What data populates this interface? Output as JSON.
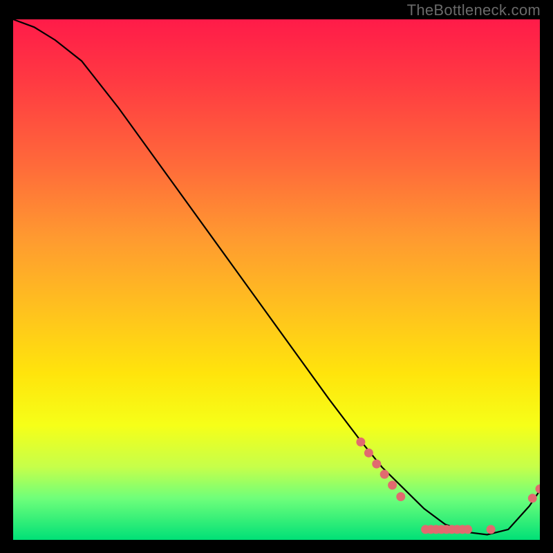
{
  "watermark": "TheBottleneck.com",
  "chart_data": {
    "type": "line",
    "title": "",
    "xlabel": "",
    "ylabel": "",
    "xlim": [
      0,
      100
    ],
    "ylim": [
      0,
      100
    ],
    "grid": false,
    "legend": false,
    "series": [
      {
        "name": "curve",
        "x": [
          0,
          4,
          8,
          13,
          20,
          30,
          40,
          50,
          60,
          66,
          70,
          74,
          78,
          82,
          86,
          90,
          94,
          98,
          100
        ],
        "y": [
          100,
          98.5,
          96,
          92,
          83,
          69,
          55,
          41,
          27,
          19,
          14,
          10,
          6,
          3,
          1.5,
          1,
          2,
          6.5,
          9.5
        ]
      }
    ],
    "markers": [
      {
        "x": 66.0,
        "y": 18.8
      },
      {
        "x": 67.5,
        "y": 16.7
      },
      {
        "x": 69.0,
        "y": 14.6
      },
      {
        "x": 70.5,
        "y": 12.6
      },
      {
        "x": 72.0,
        "y": 10.5
      },
      {
        "x": 73.6,
        "y": 8.3
      },
      {
        "x": 78.3,
        "y": 2.0
      },
      {
        "x": 79.3,
        "y": 2.0
      },
      {
        "x": 80.3,
        "y": 2.0
      },
      {
        "x": 81.3,
        "y": 2.0
      },
      {
        "x": 82.3,
        "y": 2.0
      },
      {
        "x": 83.3,
        "y": 2.0
      },
      {
        "x": 84.3,
        "y": 2.0
      },
      {
        "x": 85.3,
        "y": 2.0
      },
      {
        "x": 86.3,
        "y": 2.0
      },
      {
        "x": 90.7,
        "y": 2.0
      },
      {
        "x": 98.6,
        "y": 8.0
      },
      {
        "x": 100.0,
        "y": 9.8
      }
    ],
    "marker_color": "#e16a6f",
    "line_color": "#000000"
  }
}
